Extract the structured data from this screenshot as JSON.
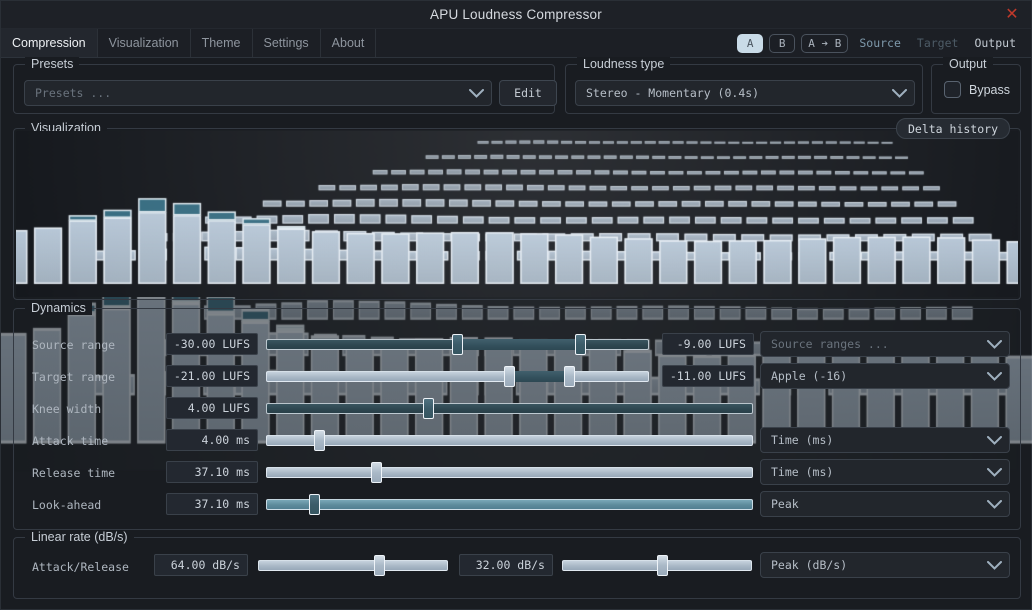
{
  "window": {
    "title": "APU Loudness Compressor",
    "close_icon": "close-icon"
  },
  "tabs": [
    {
      "label": "Compression",
      "active": true
    },
    {
      "label": "Visualization",
      "active": false
    },
    {
      "label": "Theme",
      "active": false
    },
    {
      "label": "Settings",
      "active": false
    },
    {
      "label": "About",
      "active": false
    }
  ],
  "ab_controls": {
    "a_label": "A",
    "b_label": "B",
    "copy_label": "A ➔ B",
    "source_label": "Source",
    "target_label": "Target",
    "output_label": "Output",
    "selected": "A",
    "selected_bg": "#c9dbe8",
    "link_color": "#7e99ab",
    "dim_color": "#4d5b66"
  },
  "presets": {
    "group_label": "Presets",
    "value": "Presets ...",
    "is_placeholder": true,
    "edit_label": "Edit",
    "chevron_icon": "chevron-down-icon"
  },
  "loudness_type": {
    "group_label": "Loudness type",
    "value": "Stereo - Momentary (0.4s)",
    "chevron_icon": "chevron-down-icon"
  },
  "output": {
    "group_label": "Output",
    "bypass_label": "Bypass",
    "bypass_checked": false
  },
  "visualization": {
    "group_label": "Visualization",
    "delta_history_label": "Delta history"
  },
  "dynamics": {
    "group_label": "Dynamics",
    "rows": [
      {
        "label": "Source range",
        "left_value": "-30.00 LUFS",
        "right_value": "-9.00 LUFS",
        "slider": {
          "type": "range",
          "low": 0.5,
          "high": 0.83,
          "track": "dark"
        },
        "combo": "Source ranges ...",
        "combo_placeholder": true
      },
      {
        "label": "Target range",
        "left_value": "-21.00 LUFS",
        "right_value": "-11.00 LUFS",
        "slider": {
          "type": "range",
          "low": 0.64,
          "high": 0.8,
          "track": "light"
        },
        "combo": "Apple (-16)",
        "combo_placeholder": false
      },
      {
        "label": "Knee width",
        "left_value": "4.00 LUFS",
        "right_value": null,
        "slider": {
          "type": "single",
          "pos": 0.33,
          "track": "dark"
        },
        "combo": null,
        "combo_placeholder": false
      },
      {
        "label": "Attack time",
        "left_value": "4.00 ms",
        "right_value": null,
        "slider": {
          "type": "single",
          "pos": 0.1,
          "track": "light"
        },
        "combo": "Time (ms)",
        "combo_placeholder": false
      },
      {
        "label": "Release time",
        "left_value": "37.10 ms",
        "right_value": null,
        "slider": {
          "type": "single",
          "pos": 0.22,
          "track": "light"
        },
        "combo": "Time (ms)",
        "combo_placeholder": false
      },
      {
        "label": "Look-ahead",
        "left_value": "37.10 ms",
        "right_value": null,
        "slider": {
          "type": "single",
          "pos": 0.09,
          "track": "teal"
        },
        "combo": "Peak",
        "combo_placeholder": false
      }
    ]
  },
  "linear_rate": {
    "group_label": "Linear rate (dB/s)",
    "row": {
      "label": "Attack/Release",
      "attack_value": "64.00 dB/s",
      "attack_pos": 0.65,
      "release_value": "32.00 dB/s",
      "release_pos": 0.53,
      "combo": "Peak (dB/s)"
    }
  },
  "chart_data": {
    "type": "bar",
    "title": "Loudness history (3D perspective)",
    "columns": 30,
    "rows": 9,
    "front_heights": [
      0.62,
      0.63,
      0.7,
      0.73,
      0.8,
      0.78,
      0.74,
      0.71,
      0.67,
      0.64,
      0.61,
      0.59,
      0.58,
      0.57,
      0.56,
      0.55,
      0.55,
      0.54,
      0.54,
      0.53,
      0.53,
      0.53,
      0.52,
      0.52,
      0.52,
      0.51,
      0.51,
      0.51,
      0.5,
      0.5
    ],
    "bar_fill": "#b3c3d3",
    "bar_accent": "#356b80",
    "bar_edge": "#e9f0f6",
    "background": "#15181d"
  }
}
